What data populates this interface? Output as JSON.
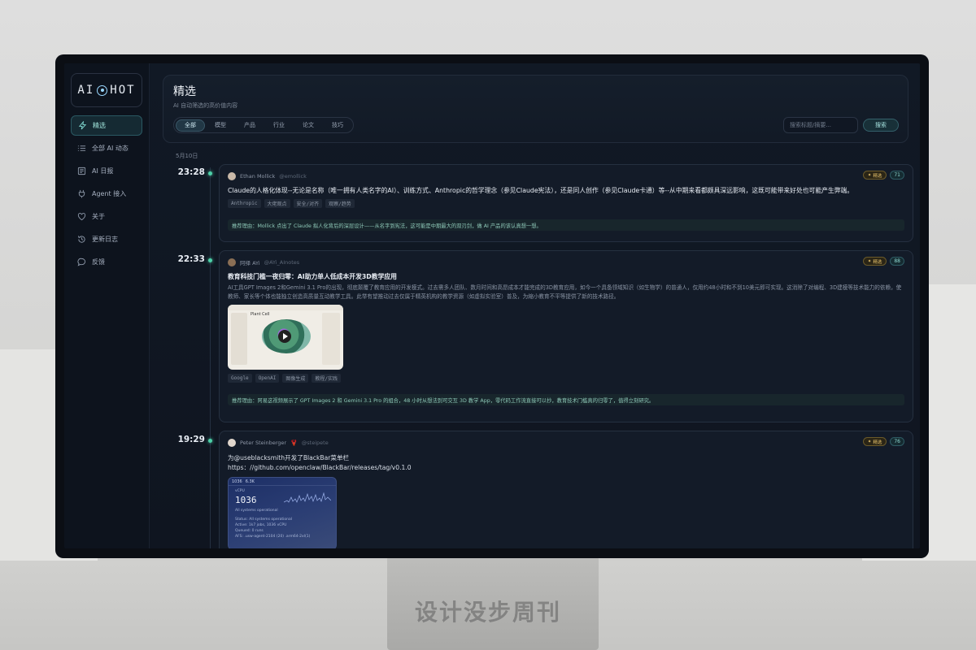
{
  "brand": {
    "logo_left": "AI",
    "logo_right": "HOT"
  },
  "sidebar": {
    "items": [
      {
        "label": "精选",
        "icon": "lightning-icon",
        "active": true
      },
      {
        "label": "全部 AI 动态",
        "icon": "list-icon"
      },
      {
        "label": "AI 日报",
        "icon": "newspaper-icon"
      },
      {
        "label": "Agent 接入",
        "icon": "plug-icon"
      },
      {
        "label": "关于",
        "icon": "heart-icon"
      },
      {
        "label": "更新日志",
        "icon": "history-icon"
      },
      {
        "label": "反馈",
        "icon": "chat-bubble-icon"
      }
    ]
  },
  "header": {
    "title": "精选",
    "subtitle": "AI 自动筛选的高价值内容",
    "tabs": [
      "全部",
      "模型",
      "产品",
      "行业",
      "论文",
      "技巧"
    ],
    "active_tab": "全部",
    "search_placeholder": "搜索标题/摘要...",
    "search_button": "搜索"
  },
  "date_label": "5月10日",
  "entries": [
    {
      "time": "23:28",
      "author": "Ethan Mollick",
      "handle": "@emollick",
      "badge": "精选",
      "score": "71",
      "title": "Claude的人格化体现--无论是名称（唯一拥有人类名字的AI）、训练方式、Anthropic的哲学理念（参见Claude宪法），还是同人创作（参见Claude卡通）等--从中期来看都颇具深远影响，这既可能带来好处也可能产生弊端。",
      "tags": [
        "Anthropic",
        "大佬观点",
        "安全/对齐",
        "观察/趋势"
      ],
      "reason": "推荐理由：Mollick 点出了 Claude 拟人化背后的深层设计——从名字到宪法，这可能是中期最大的双刃剑，做 AI 产品的该认真想一想。"
    },
    {
      "time": "22:33",
      "author": "阿绎 AYi",
      "handle": "@AYi_AInotes",
      "badge": "精选",
      "score": "88",
      "title": "教育科技门槛一夜归零：AI助力单人低成本开发3D教学应用",
      "body": "AI工具GPT Images 2和Gemini 3.1 Pro的出现，彻底颠覆了教育应用的开发模式。过去需多人团队、数月时间和高昂成本才能完成的3D教育应用，如今一个具备领域知识（如生物学）的普通人，仅用约48小时和不到10美元即可实现。这消除了对编程、3D建模等技术能力的依赖，使教师、家长等个体也能独立创造高质量互动教学工具。此举有望推动过去仅属于精英机构的教学资源（如虚拟实验室）普及，为縮小教育不平等提供了新的技术路径。",
      "media_title": "Plant Cell",
      "tags": [
        "Google",
        "OpenAI",
        "图像生成",
        "教程/实践"
      ],
      "reason": "推荐理由：阿易这视频展示了 GPT Images 2 和 Gemini 3.1 Pro 的组合，48 小时从想法到可交互 3D 教学 App，零代码工作流直接可以抄，教育技术门槛真的归零了，值得立刻研究。"
    },
    {
      "time": "19:29",
      "author": "Peter Steinberger",
      "handle": "@steipete",
      "badge": "精选",
      "score": "76",
      "title": "为@useblacksmith开发了BlackBar菜单栏",
      "body": "https：//github.com/openclaw/BlackBar/releases/tag/v0.1.0",
      "media": {
        "top": "1036",
        "top_right": "6.3K",
        "label": "vCPU",
        "big": "1036",
        "status_short": "All systems operational",
        "lines": [
          "Status: All systems operational",
          "Active: 1k7 jobs, 1036 vCPU",
          "Queued: 0 runs",
          "AFS: .usw-agent-2104 (20) .arm64-2xl(1)"
        ]
      }
    }
  ],
  "watermark": "设计没步周刊",
  "colors": {
    "accent": "#4dd0a8",
    "badge_gold": "#e5c06a",
    "score_teal": "#8fd9d2"
  }
}
